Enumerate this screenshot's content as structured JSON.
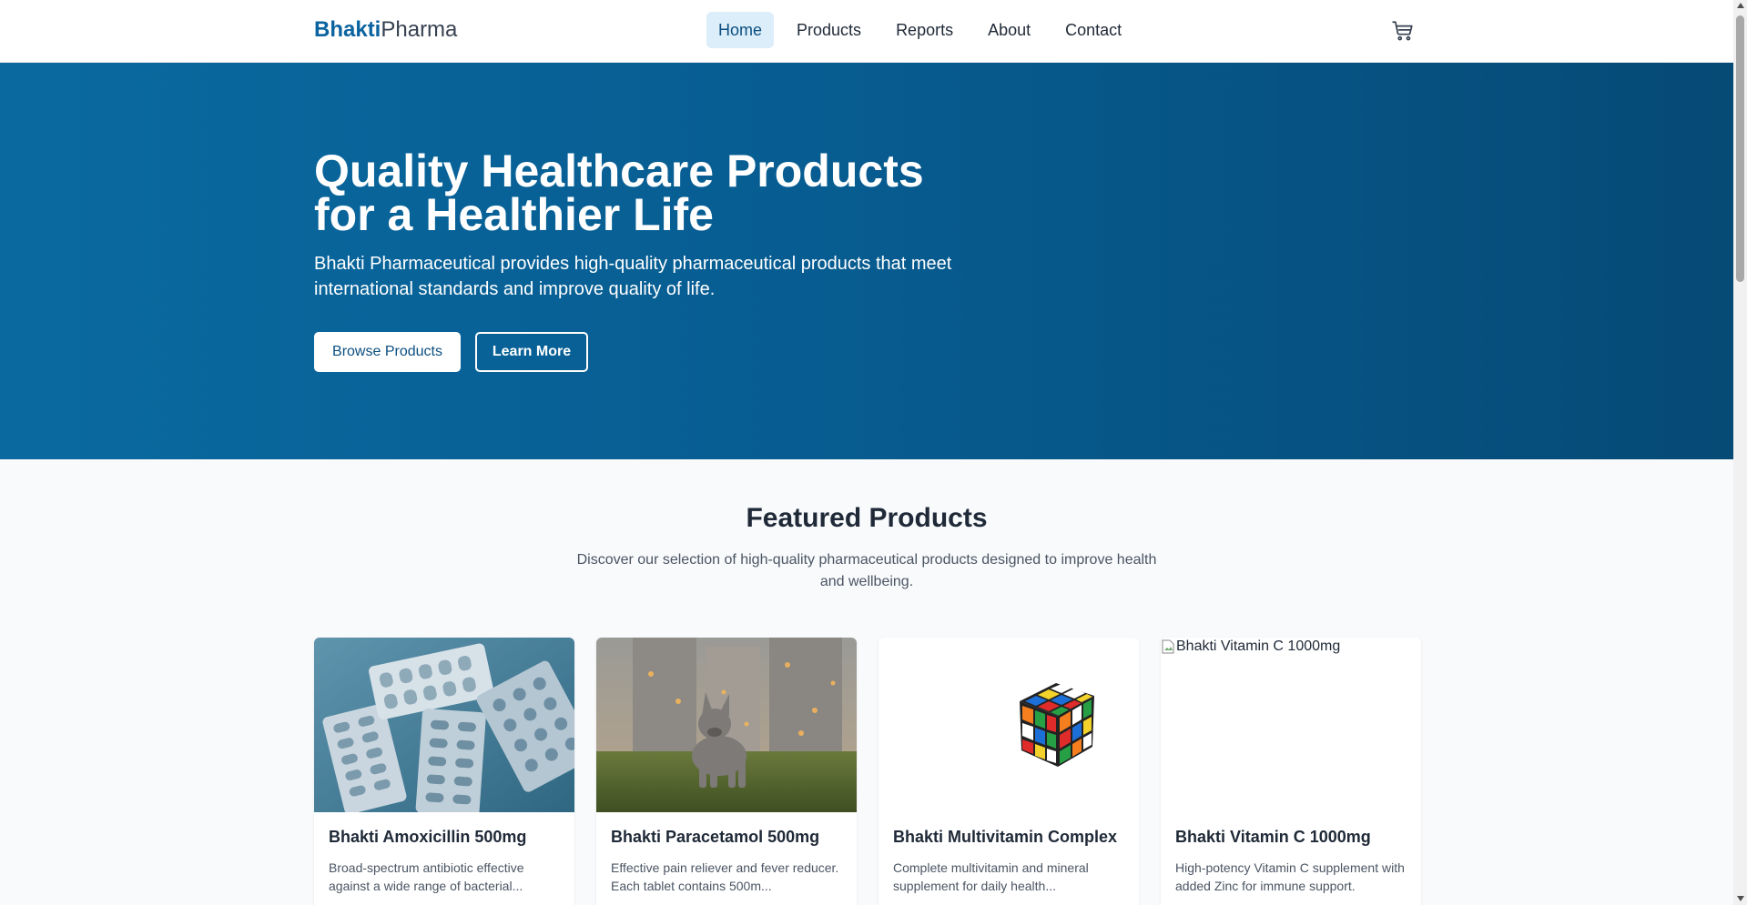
{
  "brand": {
    "part1": "Bhakti",
    "part2": "Pharma"
  },
  "nav": {
    "items": [
      {
        "label": "Home",
        "active": true
      },
      {
        "label": "Products",
        "active": false
      },
      {
        "label": "Reports",
        "active": false
      },
      {
        "label": "About",
        "active": false
      },
      {
        "label": "Contact",
        "active": false
      }
    ],
    "cart_icon": "shopping-cart-icon"
  },
  "hero": {
    "title": "Quality Healthcare Products for a Healthier Life",
    "subtitle": "Bhakti Pharmaceutical provides high-quality pharmaceutical products that meet international standards and improve quality of life.",
    "primary_button": "Browse Products",
    "secondary_button": "Learn More",
    "gradient_colors": [
      "#0a6aa0",
      "#064a76"
    ]
  },
  "featured": {
    "title": "Featured Products",
    "subtitle": "Discover our selection of high-quality pharmaceutical products designed to improve health and wellbeing.",
    "products": [
      {
        "name": "Bhakti Amoxicillin 500mg",
        "description": "Broad-spectrum antibiotic effective against a wide range of bacterial...",
        "image": "blister-packs-photo"
      },
      {
        "name": "Bhakti Paracetamol 500mg",
        "description": "Effective pain reliever and fever reducer. Each tablet contains 500m...",
        "image": "french-bulldog-photo"
      },
      {
        "name": "Bhakti Multivitamin Complex",
        "description": "Complete multivitamin and mineral supplement for daily health...",
        "image": "rubiks-cube-photo"
      },
      {
        "name": "Bhakti Vitamin C 1000mg",
        "description": "High-potency Vitamin C supplement with added Zinc for immune support.",
        "image": "broken-image",
        "image_alt": "Bhakti Vitamin C 1000mg"
      }
    ]
  },
  "colors": {
    "accent": "#0b63a0",
    "nav_active_bg": "#dbeefa"
  }
}
